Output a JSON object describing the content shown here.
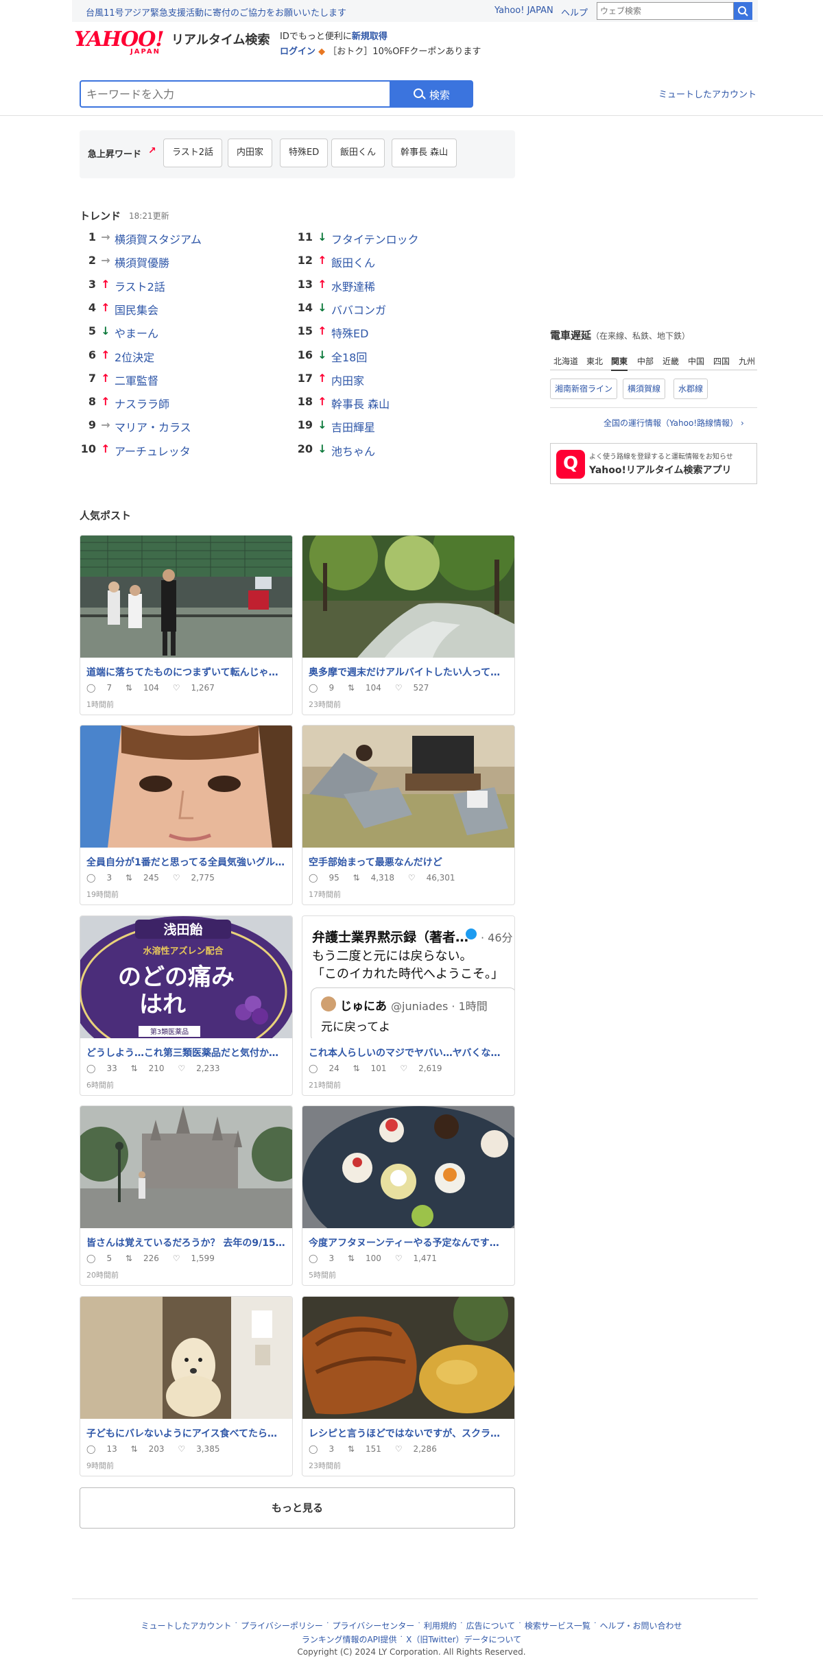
{
  "topbar": {
    "notice": "台風11号アジア緊急支援活動に寄付のご協力をお願いいたします",
    "yahoo_japan": "Yahoo! JAPAN",
    "help": "ヘルプ",
    "web_search_placeholder": "ウェブ検索"
  },
  "header": {
    "logo_text": "YAHOO!",
    "logo_sub": "JAPAN",
    "service_title": "リアルタイム検索",
    "id_prefix": "IDでもっと便利に",
    "id_register": "新規取得",
    "login": "ログイン",
    "coupon": "［おトク］10%OFFクーポンあります"
  },
  "search": {
    "placeholder": "キーワードを入力",
    "button": "検索",
    "muted_accounts": "ミュートしたアカウント"
  },
  "surge": {
    "label": "急上昇ワード",
    "words": [
      "ラスト2話",
      "内田家",
      "特殊ED",
      "飯田くん",
      "幹事長 森山"
    ]
  },
  "trend": {
    "heading": "トレンド",
    "updated": "18:21更新",
    "items": [
      {
        "rank": "1",
        "dir": "→",
        "word": "横須賀スタジアム"
      },
      {
        "rank": "2",
        "dir": "→",
        "word": "横須賀優勝"
      },
      {
        "rank": "3",
        "dir": "↑",
        "word": "ラスト2話"
      },
      {
        "rank": "4",
        "dir": "↑",
        "word": "国民集会"
      },
      {
        "rank": "5",
        "dir": "↓",
        "word": "やまーん"
      },
      {
        "rank": "6",
        "dir": "↑",
        "word": "2位決定"
      },
      {
        "rank": "7",
        "dir": "↑",
        "word": "二軍監督"
      },
      {
        "rank": "8",
        "dir": "↑",
        "word": "ナスララ師"
      },
      {
        "rank": "9",
        "dir": "→",
        "word": "マリア・カラス"
      },
      {
        "rank": "10",
        "dir": "↑",
        "word": "アーチュレッタ"
      },
      {
        "rank": "11",
        "dir": "↓",
        "word": "フタイテンロック"
      },
      {
        "rank": "12",
        "dir": "↑",
        "word": "飯田くん"
      },
      {
        "rank": "13",
        "dir": "↑",
        "word": "水野達稀"
      },
      {
        "rank": "14",
        "dir": "↓",
        "word": "ババコンガ"
      },
      {
        "rank": "15",
        "dir": "↑",
        "word": "特殊ED"
      },
      {
        "rank": "16",
        "dir": "↓",
        "word": "全18回"
      },
      {
        "rank": "17",
        "dir": "↑",
        "word": "内田家"
      },
      {
        "rank": "18",
        "dir": "↑",
        "word": "幹事長 森山"
      },
      {
        "rank": "19",
        "dir": "↓",
        "word": "吉田輝星"
      },
      {
        "rank": "20",
        "dir": "↓",
        "word": "池ちゃん"
      }
    ]
  },
  "popular": {
    "heading": "人気ポスト",
    "posts": [
      {
        "title": "道端に落ちてたものにつまずいて転んじゃ…",
        "replies": "7",
        "reposts": "104",
        "likes": "1,267",
        "time": "1時間前"
      },
      {
        "title": "奥多摩で週末だけアルバイトしたい人って…",
        "replies": "9",
        "reposts": "104",
        "likes": "527",
        "time": "23時間前"
      },
      {
        "title": "全員自分が1番だと思ってる全員気強いグル…",
        "replies": "3",
        "reposts": "245",
        "likes": "2,775",
        "time": "19時間前"
      },
      {
        "title": "空手部始まって最悪なんだけど",
        "replies": "95",
        "reposts": "4,318",
        "likes": "46,301",
        "time": "17時間前"
      },
      {
        "title": "どうしよう…これ第三類医薬品だと気付か…",
        "replies": "33",
        "reposts": "210",
        "likes": "2,233",
        "time": "6時間前"
      },
      {
        "title": "これ本人らしいのマジでヤバい…ヤバくな…",
        "replies": "24",
        "reposts": "101",
        "likes": "2,619",
        "time": "21時間前"
      },
      {
        "title": "皆さんは覚えているだろうか？ 去年の9/15…",
        "replies": "5",
        "reposts": "226",
        "likes": "1,599",
        "time": "20時間前"
      },
      {
        "title": "今度アフタヌーンティーやる予定なんです…",
        "replies": "3",
        "reposts": "100",
        "likes": "1,471",
        "time": "5時間前"
      },
      {
        "title": "子どもにバレないようにアイス食べてたら…",
        "replies": "13",
        "reposts": "203",
        "likes": "3,385",
        "time": "9時間前"
      },
      {
        "title": "レシピと言うほどではないですが、スクラ…",
        "replies": "3",
        "reposts": "151",
        "likes": "2,286",
        "time": "23時間前"
      }
    ],
    "tweet_img": {
      "name": "弁護士業界黙示録（著者…",
      "ago": "· 46分",
      "line1": "もう二度と元には戻らない。",
      "line2": "「このイカれた時代へようこそ。」",
      "quote_name": "じゅにあ",
      "quote_handle": "@juniades · 1時間",
      "quote_text": "元に戻ってよ"
    },
    "candy_img": {
      "brand": "浅田飴",
      "line": "水溶性アズレン配合",
      "big1": "のどの痛み",
      "big2": "はれ",
      "class": "第3類医薬品"
    },
    "more": "もっと見る"
  },
  "sidebar": {
    "heading": "電車遅延",
    "sub": "（在来線、私鉄、地下鉄）",
    "regions": [
      "北海道",
      "東北",
      "関東",
      "中部",
      "近畿",
      "中国",
      "四国",
      "九州"
    ],
    "active_region": "関東",
    "lines": [
      "湘南新宿ライン",
      "横須賀線",
      "水郡線"
    ],
    "info_link": "全国の運行情報（Yahoo!路線情報）",
    "app_sub": "よく使う路線を登録すると運転情報をお知らせ",
    "app_title": "Yahoo!リアルタイム検索アプリ"
  },
  "footer": {
    "row1": [
      "ミュートしたアカウント",
      "プライバシーポリシー",
      "プライバシーセンター",
      "利用規約",
      "広告について",
      "検索サービス一覧",
      "ヘルプ・お問い合わせ"
    ],
    "row2": "ランキング情報のAPI提供",
    "row2b": "X（旧Twitter）データについて",
    "copyright": "Copyright (C) 2024 LY Corporation. All Rights Reserved."
  },
  "colors": {
    "accent": "#3b74de",
    "link": "#2f57a8",
    "brand": "#ff0033",
    "up": "#ff0033",
    "down": "#0e7a3c"
  }
}
